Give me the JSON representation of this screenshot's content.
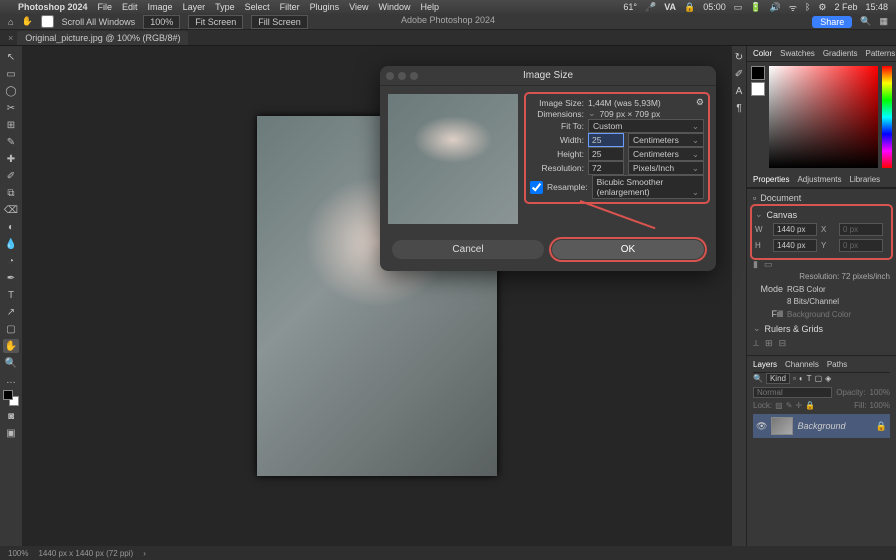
{
  "menubar": {
    "app": "Photoshop 2024",
    "items": [
      "File",
      "Edit",
      "Image",
      "Layer",
      "Type",
      "Select",
      "Filter",
      "Plugins",
      "View",
      "Window",
      "Help"
    ],
    "right": {
      "temp": "61°",
      "va": "VA",
      "time": "05:00",
      "date": "2 Feb",
      "clock": "15:48"
    }
  },
  "optbar": {
    "scroll": "Scroll All Windows",
    "zoom": "100%",
    "fit": "Fit Screen",
    "fill": "Fill Screen",
    "title": "Adobe Photoshop 2024",
    "share": "Share"
  },
  "tab": {
    "label": "Original_picture.jpg @ 100% (RGB/8#)"
  },
  "tools": [
    "↖",
    "▭",
    "◯",
    "✂",
    "✎",
    "✐",
    "⌫",
    "◐",
    "⟲",
    "T",
    "◧",
    "✦",
    "✿",
    "◆",
    "◇",
    "Q",
    "⬚",
    "⬛",
    "…"
  ],
  "dialog": {
    "title": "Image Size",
    "image_size_lbl": "Image Size:",
    "image_size_val": "1,44M (was 5,93M)",
    "dimensions_lbl": "Dimensions:",
    "dimensions_val": "709 px × 709 px",
    "fit_lbl": "Fit To:",
    "fit_val": "Custom",
    "width_lbl": "Width:",
    "width_val": "25",
    "width_unit": "Centimeters",
    "height_lbl": "Height:",
    "height_val": "25",
    "height_unit": "Centimeters",
    "res_lbl": "Resolution:",
    "res_val": "72",
    "res_unit": "Pixels/Inch",
    "resample_lbl": "Resample:",
    "resample_val": "Bicubic Smoother (enlargement)",
    "cancel": "Cancel",
    "ok": "OK"
  },
  "right": {
    "color_tabs": [
      "Color",
      "Swatches",
      "Gradients",
      "Patterns"
    ],
    "prop_tabs": [
      "Properties",
      "Adjustments",
      "Libraries"
    ],
    "doc": "Document",
    "canvas_title": "Canvas",
    "w_lbl": "W",
    "w_val": "1440 px",
    "x_lbl": "X",
    "x_val": "0 px",
    "h_lbl": "H",
    "h_val": "1440 px",
    "y_lbl": "Y",
    "y_val": "0 px",
    "res_line": "Resolution: 72 pixels/inch",
    "mode_lbl": "Mode",
    "mode_val": "RGB Color",
    "bits": "8 Bits/Channel",
    "fill_lbl": "Fill",
    "fill_val": "Background Color",
    "rulers": "Rulers & Grids",
    "layer_tabs": [
      "Layers",
      "Channels",
      "Paths"
    ],
    "kind": "Kind",
    "blend": "Normal",
    "opacity_lbl": "Opacity:",
    "opacity_val": "100%",
    "lock": "Lock:",
    "fill2_lbl": "Fill:",
    "fill2_val": "100%",
    "bg_layer": "Background"
  },
  "status": {
    "zoom": "100%",
    "dims": "1440 px x 1440 px (72 ppi)"
  }
}
